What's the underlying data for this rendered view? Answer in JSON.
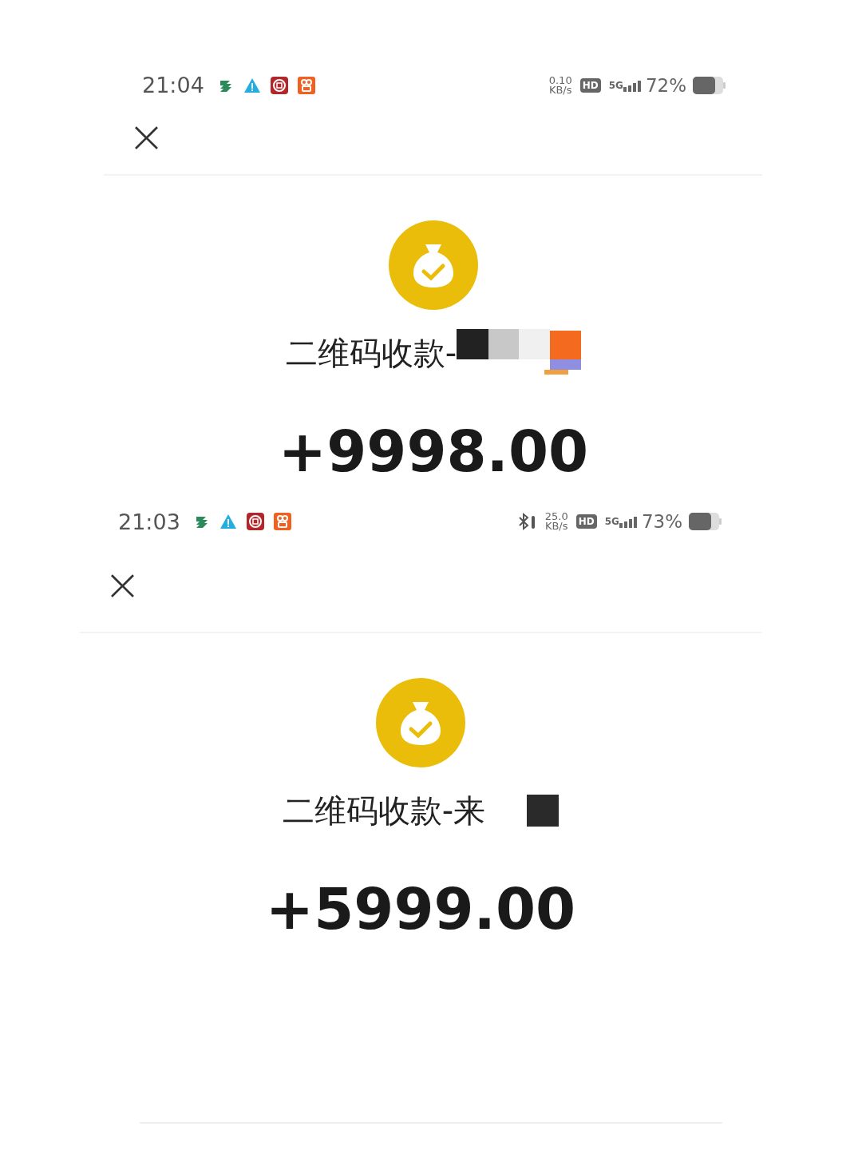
{
  "screens": [
    {
      "status_bar": {
        "time": "21:04",
        "bluetooth": false,
        "speed_value": "0.10",
        "speed_unit": "KB/s",
        "hd": "HD",
        "network": "5G",
        "battery": "72%"
      },
      "close": "×",
      "title": "二维码收款-",
      "redaction": {
        "kind": "mosaic"
      },
      "amount": "+9998.00"
    },
    {
      "status_bar": {
        "time": "21:03",
        "bluetooth": true,
        "speed_value": "25.0",
        "speed_unit": "KB/s",
        "hd": "HD",
        "network": "5G",
        "battery": "73%"
      },
      "close": "×",
      "title": "二维码收款-来",
      "redaction": {
        "kind": "block"
      },
      "amount": "+5999.00"
    }
  ]
}
